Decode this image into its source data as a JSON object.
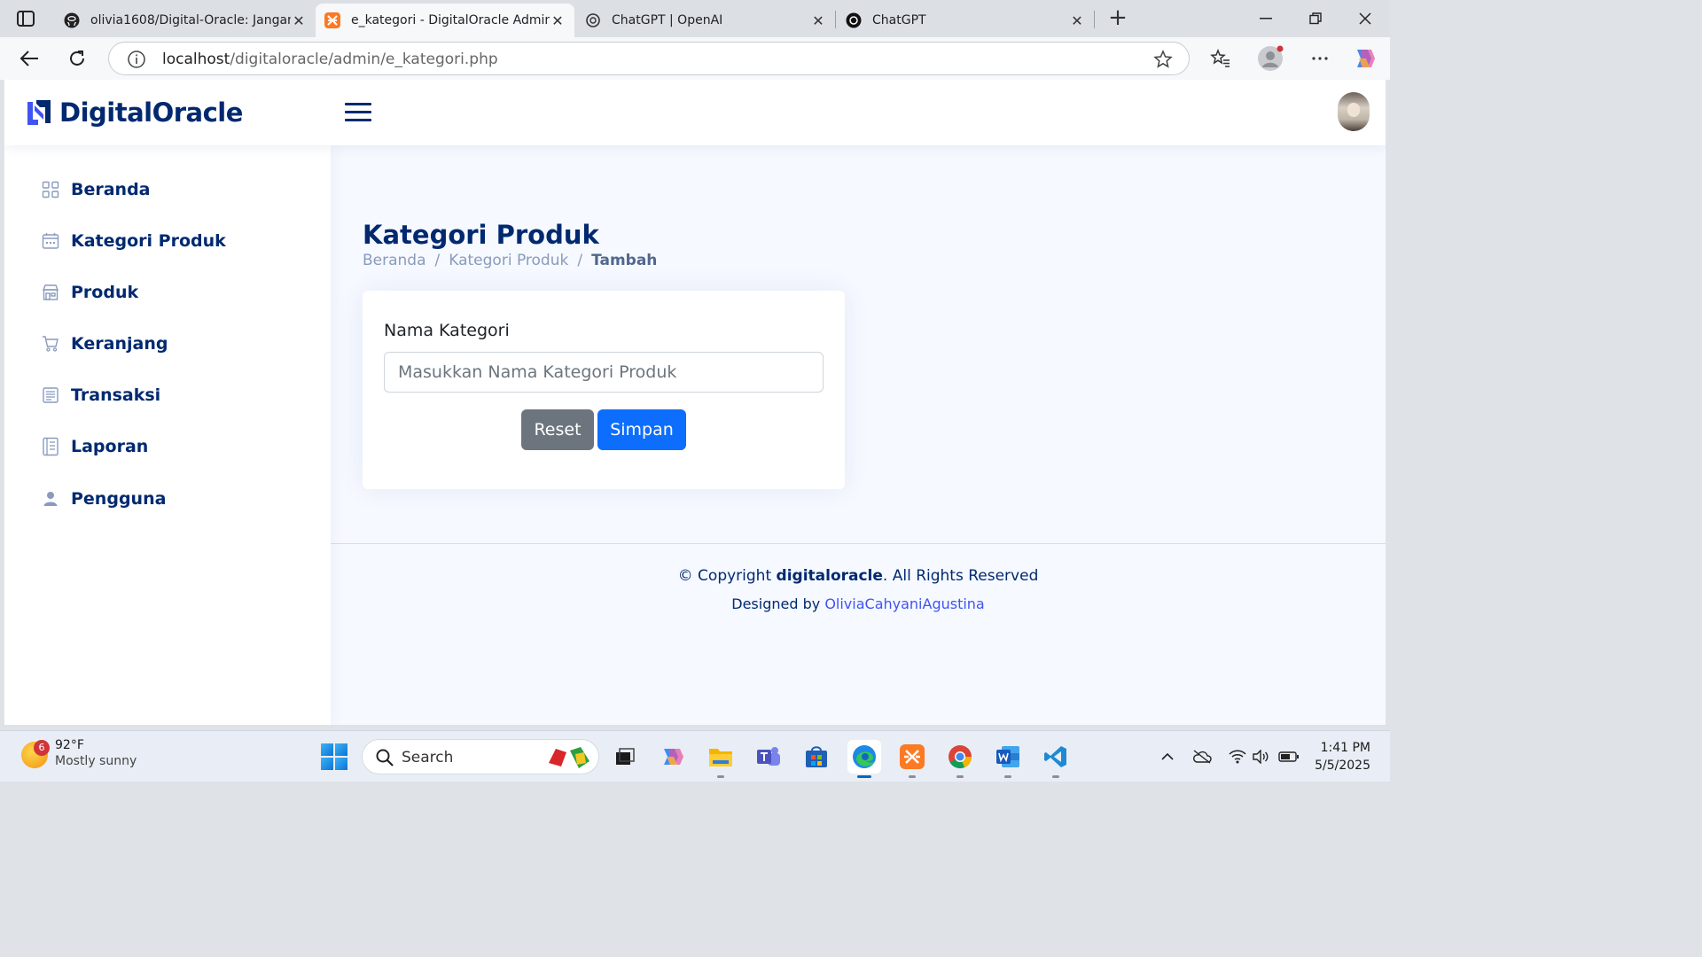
{
  "browser": {
    "tabs": [
      {
        "title": "olivia1608/Digital-Oracle: Jangan",
        "icon": "github-icon",
        "active": false
      },
      {
        "title": "e_kategori - DigitalOracle Admin",
        "icon": "xampp-icon",
        "active": true
      },
      {
        "title": "ChatGPT | OpenAI",
        "icon": "openai-icon",
        "active": false
      },
      {
        "title": "ChatGPT",
        "icon": "openai-icon",
        "active": false
      }
    ],
    "close_glyph": "✕",
    "new_tab_glyph": "+",
    "url_host": "localhost",
    "url_path": "/digitaloracle/admin/e_kategori.php"
  },
  "app": {
    "brand": "DigitalOracle",
    "colors": {
      "primary": "#012970",
      "accent": "#4154f1",
      "muted": "#899bbd",
      "background": "#f6f9ff"
    }
  },
  "sidebar": {
    "items": [
      {
        "label": "Beranda",
        "icon": "grid-icon"
      },
      {
        "label": "Kategori Produk",
        "icon": "calendar-icon"
      },
      {
        "label": "Produk",
        "icon": "shop-icon"
      },
      {
        "label": "Keranjang",
        "icon": "cart-icon"
      },
      {
        "label": "Transaksi",
        "icon": "receipt-icon"
      },
      {
        "label": "Laporan",
        "icon": "journal-icon"
      },
      {
        "label": "Pengguna",
        "icon": "person-icon"
      }
    ]
  },
  "main": {
    "title": "Kategori Produk",
    "breadcrumb": [
      "Beranda",
      "Kategori Produk",
      "Tambah"
    ],
    "breadcrumb_separator": "/",
    "form": {
      "label": "Nama Kategori",
      "placeholder": "Masukkan Nama Kategori Produk",
      "value": "",
      "reset_label": "Reset",
      "submit_label": "Simpan"
    }
  },
  "footer": {
    "copyright_prefix": "© Copyright",
    "copyright_brand": "digitaloracle",
    "copyright_suffix": ". All Rights Reserved",
    "designed_by": "Designed by",
    "designer": "OliviaCahyaniAgustina"
  },
  "taskbar": {
    "weather_temp": "92°F",
    "weather_desc": "Mostly sunny",
    "weather_badge": "6",
    "search_label": "Search",
    "time": "1:41 PM",
    "date": "5/5/2025",
    "apps": [
      "task-view-icon",
      "copilot-icon",
      "file-explorer-icon",
      "teams-icon",
      "store-icon",
      "edge-icon",
      "xampp-icon",
      "chrome-icon",
      "word-icon",
      "vscode-icon"
    ]
  }
}
